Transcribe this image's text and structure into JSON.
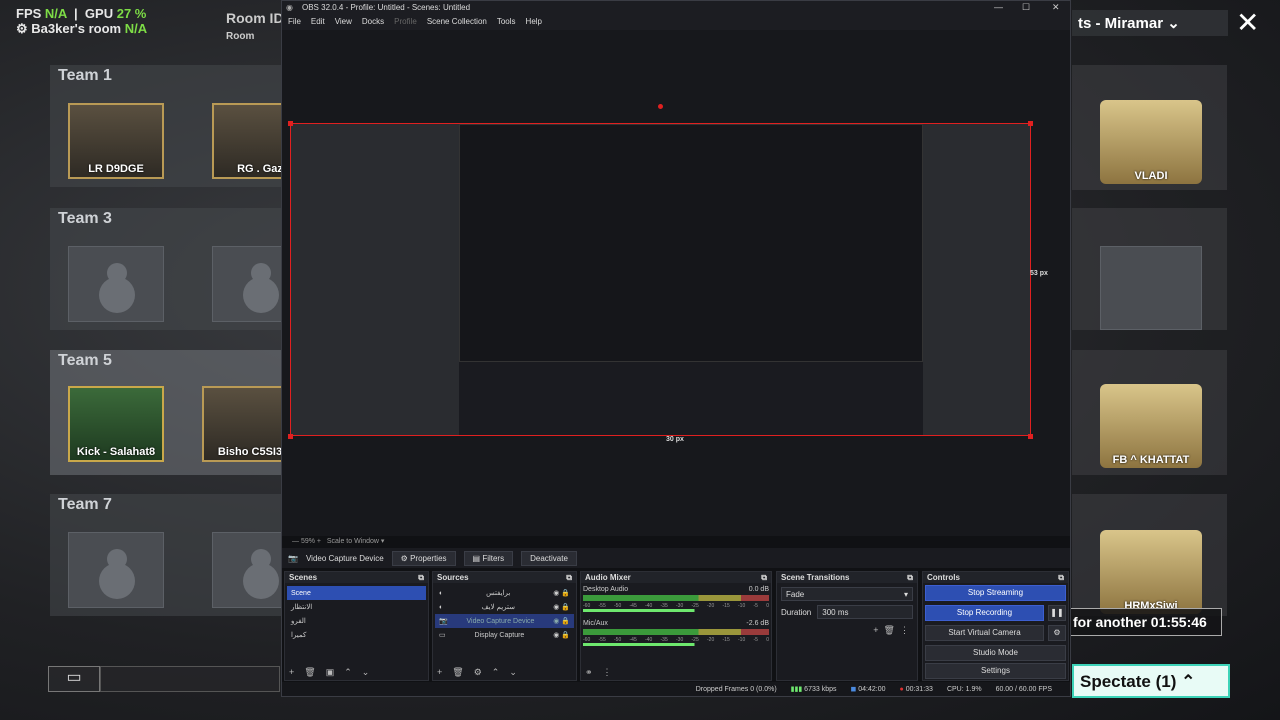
{
  "game": {
    "hud_fps": "FPS",
    "hud_fps_val": "N/A",
    "hud_gpu": "GPU",
    "hud_gpu_val": "27 %",
    "hud_user": "Ba3ker's room",
    "hud_na2": "N/A",
    "room_id": "Room ID",
    "room_sub": "Room",
    "map_title": "ts - Miramar",
    "teams": [
      {
        "label": "Team 1",
        "players": [
          "LR D9DGE",
          "RG . Gaz"
        ]
      },
      {
        "label": "Team 3",
        "players": [
          "",
          ""
        ]
      },
      {
        "label": "Team 5",
        "players": [
          "Kick - Salahat8",
          "Bisho C5SI3"
        ]
      },
      {
        "label": "Team 7",
        "players": [
          "",
          ""
        ]
      }
    ],
    "right_players": [
      "VLADI",
      "",
      "FB ^ KHATTAT",
      "HRMxSiwi"
    ],
    "wait_text": "for another 01:55:46",
    "spectate_label": "Spectate (1)",
    "chat_icon": "chat-icon"
  },
  "obs": {
    "title": "OBS 32.0.4 - Profile: Untitled - Scenes: Untitled",
    "menu": [
      "File",
      "Edit",
      "View",
      "Docks",
      "Profile",
      "Scene Collection",
      "Tools",
      "Help"
    ],
    "measure_right": "53 px",
    "measure_bottom": "30 px",
    "zoom": "59%",
    "scale_mode": "Scale to Window",
    "source_name": "Video Capture Device",
    "properties_label": "Properties",
    "filters_label": "Filters",
    "deactivate_label": "Deactivate",
    "scenes": {
      "header": "Scenes",
      "items": [
        "Scene",
        "الانتظار",
        "الفرو",
        "كميرا"
      ]
    },
    "sources": {
      "header": "Sources",
      "items": [
        "برايفتس",
        "ستريم لايف",
        "Video Capture Device",
        "Display Capture"
      ]
    },
    "mixer": {
      "header": "Audio Mixer",
      "channels": [
        {
          "name": "Desktop Audio",
          "db": "0.0 dB"
        },
        {
          "name": "Mic/Aux",
          "db": "-2.6 dB"
        }
      ],
      "scale": [
        "-60",
        "-55",
        "-50",
        "-45",
        "-40",
        "-35",
        "-30",
        "-25",
        "-20",
        "-15",
        "-10",
        "-5",
        "0"
      ]
    },
    "transitions": {
      "header": "Scene Transitions",
      "type": "Fade",
      "duration_label": "Duration",
      "duration_value": "300 ms"
    },
    "controls": {
      "header": "Controls",
      "stop_streaming": "Stop Streaming",
      "stop_recording": "Stop Recording",
      "virtual_camera": "Start Virtual Camera",
      "studio_mode": "Studio Mode",
      "settings": "Settings"
    },
    "status": {
      "dropped": "Dropped Frames 0 (0.0%)",
      "bitrate": "6733 kbps",
      "stream_time": "04:42:00",
      "rec_time": "00:31:33",
      "cpu": "CPU: 1.9%",
      "fps": "60.00 / 60.00 FPS"
    },
    "colors": {
      "accent": "#2d4fb2",
      "selection": "#e02020"
    }
  }
}
